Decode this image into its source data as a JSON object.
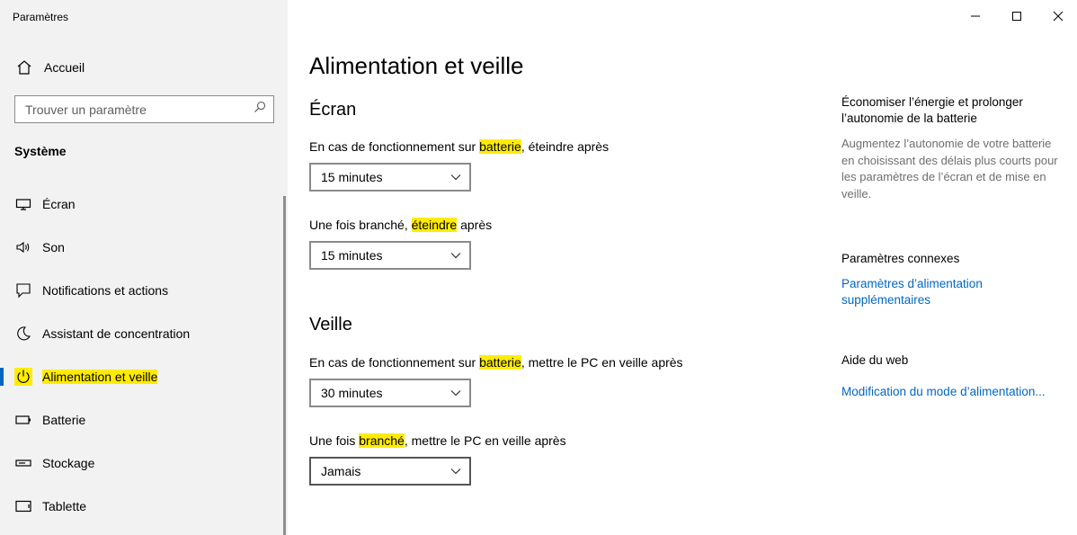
{
  "window": {
    "title": "Paramètres",
    "controls": {
      "minimize": "minimize-icon",
      "maximize": "maximize-icon",
      "close": "close-icon"
    }
  },
  "sidebar": {
    "home_label": "Accueil",
    "search_placeholder": "Trouver un paramètre",
    "group_title": "Système",
    "items": [
      {
        "label": "Écran",
        "icon": "monitor-icon",
        "active": false
      },
      {
        "label": "Son",
        "icon": "speaker-icon",
        "active": false
      },
      {
        "label": "Notifications et actions",
        "icon": "notification-icon",
        "active": false
      },
      {
        "label": "Assistant de concentration",
        "icon": "moon-icon",
        "active": false
      },
      {
        "label": "Alimentation et veille",
        "icon": "power-icon",
        "active": true
      },
      {
        "label": "Batterie",
        "icon": "battery-icon",
        "active": false
      },
      {
        "label": "Stockage",
        "icon": "storage-icon",
        "active": false
      },
      {
        "label": "Tablette",
        "icon": "tablet-icon",
        "active": false
      }
    ]
  },
  "main": {
    "title": "Alimentation et veille",
    "screen": {
      "title": "Écran",
      "battery_label": {
        "pre": "En cas de fonctionnement sur ",
        "hl": "batterie",
        "post": ", éteindre après"
      },
      "battery_value": "15 minutes",
      "plugged_label": {
        "pre": "Une fois branché, ",
        "hl": "éteindre",
        "post": " après"
      },
      "plugged_value": "15 minutes"
    },
    "sleep": {
      "title": "Veille",
      "battery_label": {
        "pre": "En cas de fonctionnement sur ",
        "hl": "batterie",
        "post": ", mettre le PC en veille après"
      },
      "battery_value": "30 minutes",
      "plugged_label": {
        "pre": "Une fois ",
        "hl": "branché",
        "post": ", mettre le PC en veille après"
      },
      "plugged_value": "Jamais"
    }
  },
  "right_panel": {
    "save_title": "Économiser l’énergie et prolonger l’autonomie de la batterie",
    "save_text": "Augmentez l’autonomie de votre batterie en choisissant des délais plus courts pour les paramètres de l’écran et de mise en veille.",
    "related_title": "Paramètres connexes",
    "related_link": "Paramètres d’alimentation supplémentaires",
    "web_title": "Aide du web",
    "web_link": "Modification du mode d’alimentation..."
  },
  "colors": {
    "highlight": "#ffec00",
    "accent": "#0067c0",
    "sidebar_bg": "#f2f2f2"
  }
}
